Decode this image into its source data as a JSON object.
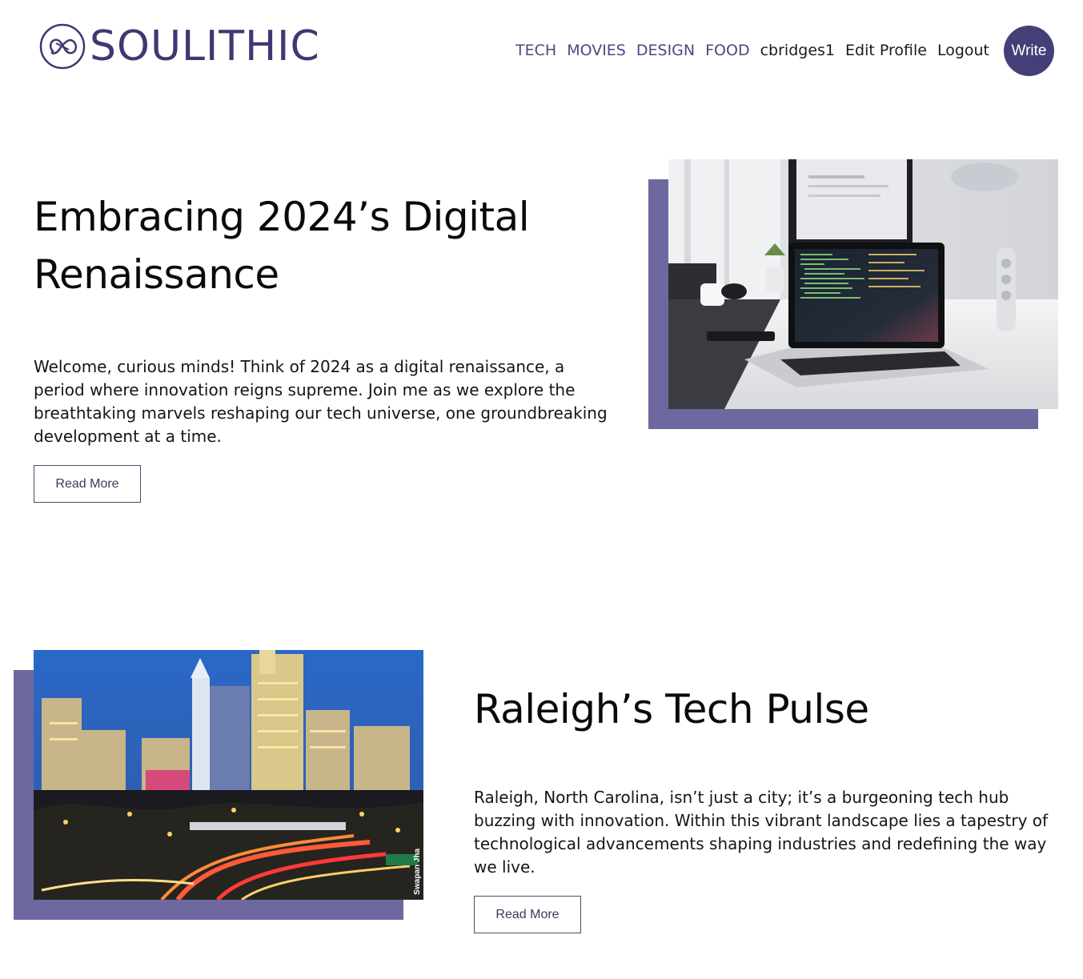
{
  "brand": {
    "name": "SOULITHIC",
    "color": "#3e3872"
  },
  "nav": {
    "categories": [
      "TECH",
      "MOVIES",
      "DESIGN",
      "FOOD"
    ],
    "username": "cbridges1",
    "edit_profile": "Edit Profile",
    "logout": "Logout",
    "write": "Write"
  },
  "posts": [
    {
      "title": "Embracing 2024’s Digital Renaissance",
      "excerpt": "Welcome, curious minds! Think of 2024 as a digital renaissance, a period where innovation reigns supreme. Join me as we explore the breathtaking marvels reshaping our tech universe, one groundbreaking development at a time.",
      "read_more": "Read More",
      "image": "laptop-on-desk-photo"
    },
    {
      "title": "Raleigh’s Tech Pulse",
      "excerpt": "Raleigh, North Carolina, isn’t just a city; it’s a burgeoning tech hub buzzing with innovation. Within this vibrant landscape lies a tapestry of technological advancements shaping industries and redefining the way we live.",
      "read_more": "Read More",
      "image": "raleigh-skyline-photo",
      "image_credit": "Swapan Jha"
    }
  ],
  "colors": {
    "accent": "#453f77",
    "image_shadow": "#6e68a0"
  }
}
